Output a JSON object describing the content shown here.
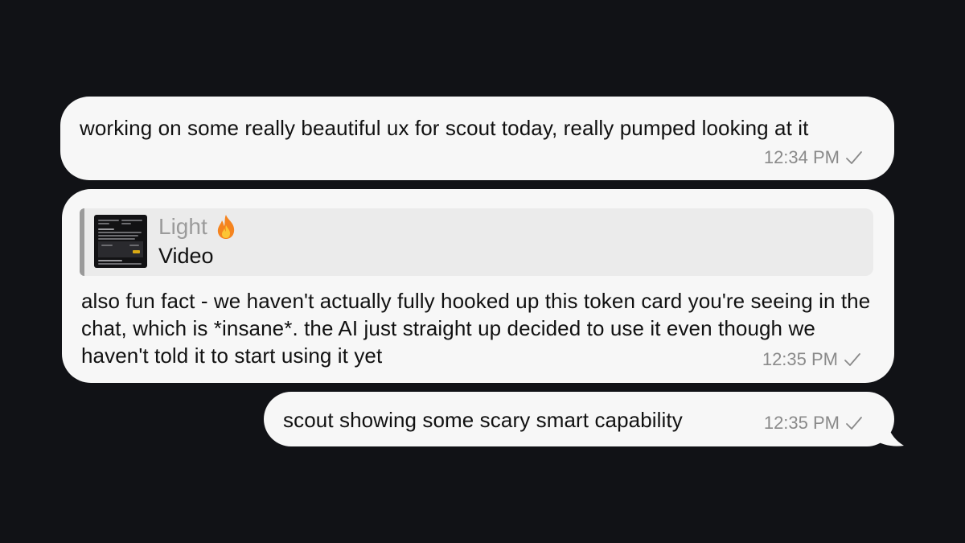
{
  "messages": [
    {
      "text": "working on some really beautiful ux for scout today, really pumped looking at it",
      "time": "12:34 PM",
      "status_icon": "check-icon"
    },
    {
      "reply": {
        "name": "Light",
        "name_emoji": "fire-icon",
        "subtitle": "Video",
        "thumbnail": "video-thumbnail"
      },
      "text": "also fun fact - we haven't actually fully hooked up this token card you're seeing in the chat, which is *insane*. the AI just straight up decided to use it even though we haven't told it to start using it yet",
      "time": "12:35 PM",
      "status_icon": "check-icon"
    },
    {
      "text": "scout showing some scary smart capability",
      "time": "12:35 PM",
      "status_icon": "check-icon"
    }
  ],
  "colors": {
    "background": "#111216",
    "bubble": "#f7f7f7",
    "reply_background": "#ebebeb",
    "reply_accent": "#9a9a9a",
    "timestamp": "#8a8a8a",
    "fire": "#f5841f"
  }
}
